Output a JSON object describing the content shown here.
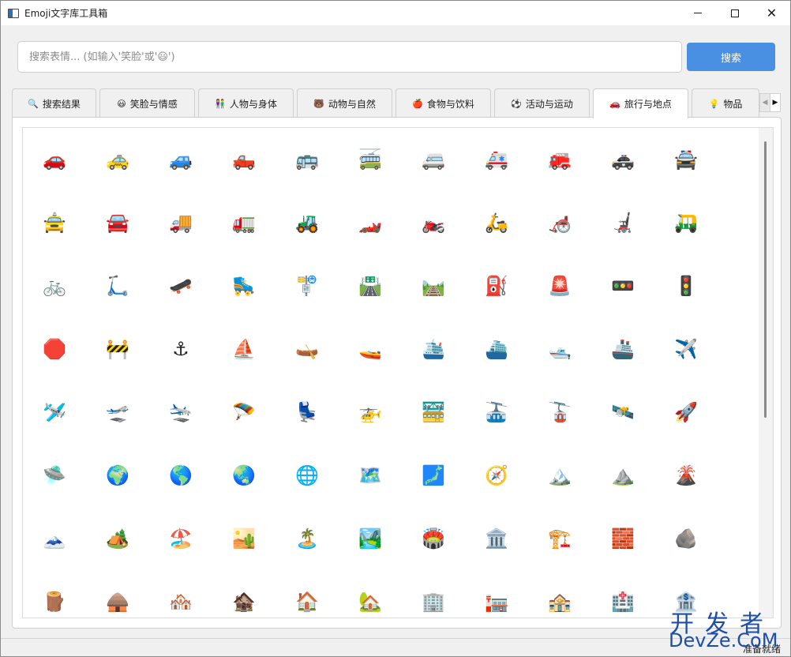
{
  "window": {
    "title": "Emoji文字库工具箱",
    "controls": {
      "minimize": "",
      "maximize": "",
      "close": "✕"
    }
  },
  "search": {
    "placeholder": "搜索表情... (如输入'笑脸'或'😃')",
    "value": "",
    "button_label": "搜索"
  },
  "tabs": [
    {
      "emoji": "🔍",
      "label": "搜索结果",
      "active": false
    },
    {
      "emoji": "😃",
      "label": "笑脸与情感",
      "active": false
    },
    {
      "emoji": "👫",
      "label": "人物与身体",
      "active": false
    },
    {
      "emoji": "🐻",
      "label": "动物与自然",
      "active": false
    },
    {
      "emoji": "🍎",
      "label": "食物与饮料",
      "active": false
    },
    {
      "emoji": "⚽",
      "label": "活动与运动",
      "active": false
    },
    {
      "emoji": "🚗",
      "label": "旅行与地点",
      "active": true
    },
    {
      "emoji": "💡",
      "label": "物品",
      "active": false
    }
  ],
  "tab_scroll": {
    "left": "◀",
    "right": "▶"
  },
  "emoji_grid": [
    [
      "🚗",
      "🚕",
      "🚙",
      "🛻",
      "🚌",
      "🚎",
      "🚐",
      "🚑",
      "🚒",
      "🚓",
      "🚔"
    ],
    [
      "🚖",
      "🚘",
      "🚚",
      "🚛",
      "🚜",
      "🏎️",
      "🏍️",
      "🛵",
      "🦽",
      "🦼",
      "🛺"
    ],
    [
      "🚲",
      "🛴",
      "🛹",
      "🛼",
      "🚏",
      "🛣️",
      "🛤️",
      "⛽",
      "🚨",
      "🚥",
      "🚦"
    ],
    [
      "🛑",
      "🚧",
      "⚓",
      "⛵",
      "🛶",
      "🚤",
      "🛳️",
      "⛴️",
      "🛥️",
      "🚢",
      "✈️"
    ],
    [
      "🛩️",
      "🛫",
      "🛬",
      "🪂",
      "💺",
      "🚁",
      "🚟",
      "🚠",
      "🚡",
      "🛰️",
      "🚀"
    ],
    [
      "🛸",
      "🌍",
      "🌎",
      "🌏",
      "🌐",
      "🗺️",
      "🗾",
      "🧭",
      "🏔️",
      "⛰️",
      "🌋"
    ],
    [
      "🗻",
      "🏕️",
      "🏖️",
      "🏜️",
      "🏝️",
      "🏞️",
      "🏟️",
      "🏛️",
      "🏗️",
      "🧱",
      "🪨"
    ],
    [
      "🪵",
      "🛖",
      "🏘️",
      "🏚️",
      "🏠",
      "🏡",
      "🏢",
      "🏣",
      "🏤",
      "🏥",
      "🏦"
    ]
  ],
  "status": {
    "text": "准备就绪"
  },
  "watermark": {
    "top": "开发者",
    "bottom": "DevZe.CoM"
  }
}
